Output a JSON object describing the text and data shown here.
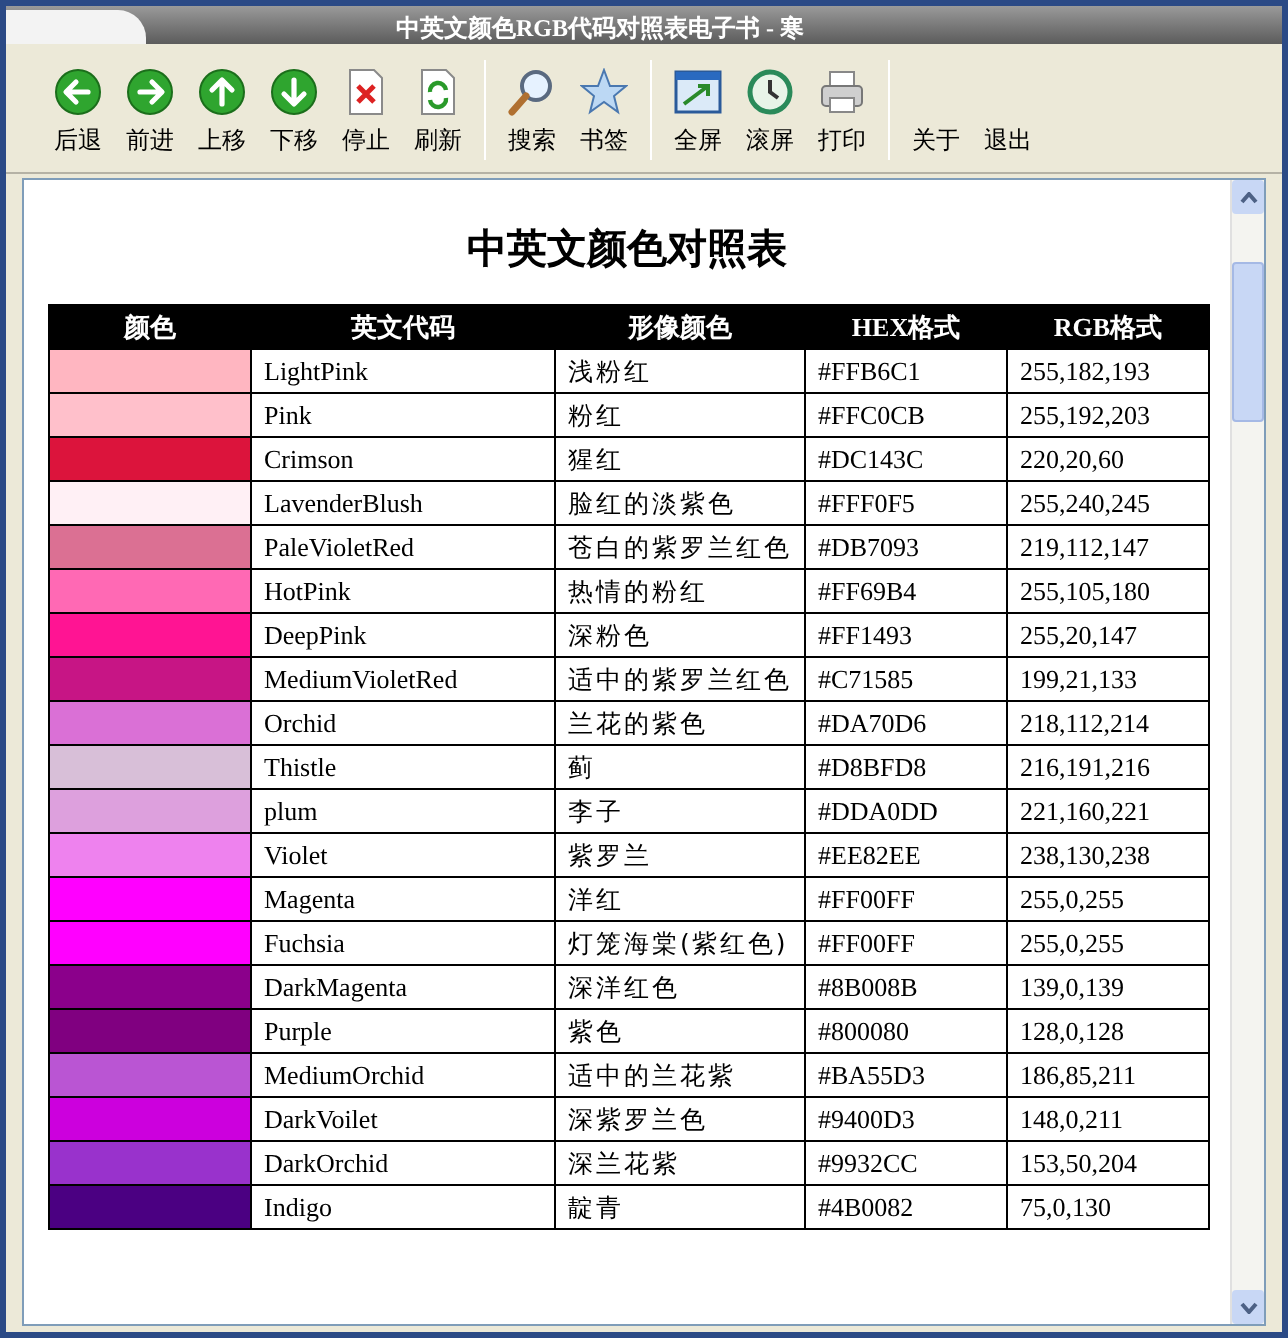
{
  "window": {
    "title": "中英文颜色RGB代码对照表电子书 - 寒"
  },
  "toolbar": {
    "groups": [
      [
        {
          "label": "后退",
          "kind": "left"
        },
        {
          "label": "前进",
          "kind": "right"
        },
        {
          "label": "上移",
          "kind": "up"
        },
        {
          "label": "下移",
          "kind": "down"
        },
        {
          "label": "停止",
          "kind": "stop"
        },
        {
          "label": "刷新",
          "kind": "refresh"
        }
      ],
      [
        {
          "label": "搜索",
          "kind": "search"
        },
        {
          "label": "书签",
          "kind": "star"
        }
      ],
      [
        {
          "label": "全屏",
          "kind": "fullscreen"
        },
        {
          "label": "滚屏",
          "kind": "clock"
        },
        {
          "label": "打印",
          "kind": "print"
        }
      ],
      [
        {
          "label": "关于",
          "kind": "none"
        },
        {
          "label": "退出",
          "kind": "none"
        }
      ]
    ]
  },
  "page": {
    "heading": "中英文颜色对照表",
    "table": {
      "columns": [
        "颜色",
        "英文代码",
        "形像颜色",
        "HEX格式",
        "RGB格式"
      ],
      "rows": [
        {
          "color": "#ffb6c1",
          "name": "LightPink",
          "chinese": "浅粉红",
          "hex": "#FFB6C1",
          "rgb": "255,182,193"
        },
        {
          "color": "#ffc0cb",
          "name": "Pink",
          "chinese": "粉红",
          "hex": "#FFC0CB",
          "rgb": "255,192,203"
        },
        {
          "color": "#dc143c",
          "name": "Crimson",
          "chinese": "猩红",
          "hex": "#DC143C",
          "rgb": "220,20,60"
        },
        {
          "color": "#fff0f5",
          "name": "LavenderBlush",
          "chinese": "脸红的淡紫色",
          "hex": "#FFF0F5",
          "rgb": "255,240,245"
        },
        {
          "color": "#db7093",
          "name": "PaleVioletRed",
          "chinese": "苍白的紫罗兰红色",
          "hex": "#DB7093",
          "rgb": "219,112,147"
        },
        {
          "color": "#ff69b4",
          "name": "HotPink",
          "chinese": "热情的粉红",
          "hex": "#FF69B4",
          "rgb": "255,105,180"
        },
        {
          "color": "#ff1493",
          "name": "DeepPink",
          "chinese": "深粉色",
          "hex": "#FF1493",
          "rgb": "255,20,147"
        },
        {
          "color": "#c71585",
          "name": "MediumVioletRed",
          "chinese": "适中的紫罗兰红色",
          "hex": "#C71585",
          "rgb": "199,21,133"
        },
        {
          "color": "#da70d6",
          "name": "Orchid",
          "chinese": "兰花的紫色",
          "hex": "#DA70D6",
          "rgb": "218,112,214"
        },
        {
          "color": "#d8bfd8",
          "name": "Thistle",
          "chinese": "蓟",
          "hex": "#D8BFD8",
          "rgb": "216,191,216"
        },
        {
          "color": "#dda0dd",
          "name": "plum",
          "chinese": "李子",
          "hex": "#DDA0DD",
          "rgb": "221,160,221"
        },
        {
          "color": "#ee82ee",
          "name": "Violet",
          "chinese": "紫罗兰",
          "hex": "#EE82EE",
          "rgb": "238,130,238"
        },
        {
          "color": "#ff00ff",
          "name": "Magenta",
          "chinese": "洋红",
          "hex": "#FF00FF",
          "rgb": "255,0,255"
        },
        {
          "color": "#ff00ff",
          "name": "Fuchsia",
          "chinese": "灯笼海棠(紫红色)",
          "hex": "#FF00FF",
          "rgb": "255,0,255"
        },
        {
          "color": "#8b008b",
          "name": "DarkMagenta",
          "chinese": "深洋红色",
          "hex": "#8B008B",
          "rgb": "139,0,139"
        },
        {
          "color": "#800080",
          "name": "Purple",
          "chinese": "紫色",
          "hex": "#800080",
          "rgb": "128,0,128"
        },
        {
          "color": "#ba55d3",
          "name": "MediumOrchid",
          "chinese": "适中的兰花紫",
          "hex": "#BA55D3",
          "rgb": "186,85,211"
        },
        {
          "color": "#cc00dd",
          "name": "DarkVoilet",
          "chinese": "深紫罗兰色",
          "hex": "#9400D3",
          "rgb": "148,0,211"
        },
        {
          "color": "#9932cc",
          "name": "DarkOrchid",
          "chinese": "深兰花紫",
          "hex": "#9932CC",
          "rgb": "153,50,204"
        },
        {
          "color": "#4b0082",
          "name": "Indigo",
          "chinese": "靛青",
          "hex": "#4B0082",
          "rgb": "75,0,130"
        }
      ]
    }
  }
}
